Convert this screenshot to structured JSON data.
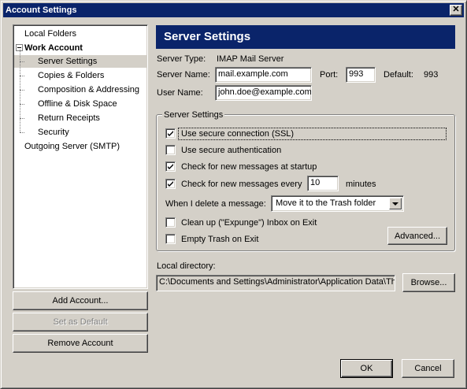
{
  "window": {
    "title": "Account Settings",
    "close_glyph": "✕"
  },
  "tree": {
    "items": [
      {
        "label": "Local Folders"
      },
      {
        "label": "Work Account"
      },
      {
        "label": "Server Settings"
      },
      {
        "label": "Copies & Folders"
      },
      {
        "label": "Composition & Addressing"
      },
      {
        "label": "Offline & Disk Space"
      },
      {
        "label": "Return Receipts"
      },
      {
        "label": "Security"
      },
      {
        "label": "Outgoing Server (SMTP)"
      }
    ]
  },
  "left_buttons": {
    "add_account": "Add Account...",
    "set_default": "Set as Default",
    "remove_account": "Remove Account"
  },
  "panel": {
    "header": "Server Settings",
    "server_type_label": "Server Type:",
    "server_type_value": "IMAP Mail Server",
    "server_name_label": "Server Name:",
    "server_name_value": "mail.example.com",
    "port_label": "Port:",
    "port_value": "993",
    "default_label": "Default:",
    "default_value": "993",
    "user_name_label": "User Name:",
    "user_name_value": "john.doe@example.com"
  },
  "group": {
    "legend": "Server Settings",
    "ssl_label": "Use secure connection (SSL)",
    "ssl_checked": true,
    "secure_auth_label": "Use secure authentication",
    "secure_auth_checked": false,
    "check_startup_label": "Check for new messages at startup",
    "check_startup_checked": true,
    "check_every_label": "Check for new messages every",
    "check_every_checked": true,
    "check_every_value": "10",
    "minutes_label": "minutes",
    "delete_label": "When I delete a message:",
    "delete_value": "Move it to the Trash folder",
    "expunge_label": "Clean up (\"Expunge\") Inbox on Exit",
    "expunge_checked": false,
    "empty_trash_label": "Empty Trash on Exit",
    "empty_trash_checked": false,
    "advanced_button": "Advanced..."
  },
  "local_dir": {
    "label": "Local directory:",
    "value": "C:\\Documents and Settings\\Administrator\\Application Data\\Thu",
    "browse_button": "Browse..."
  },
  "footer": {
    "ok": "OK",
    "cancel": "Cancel"
  }
}
